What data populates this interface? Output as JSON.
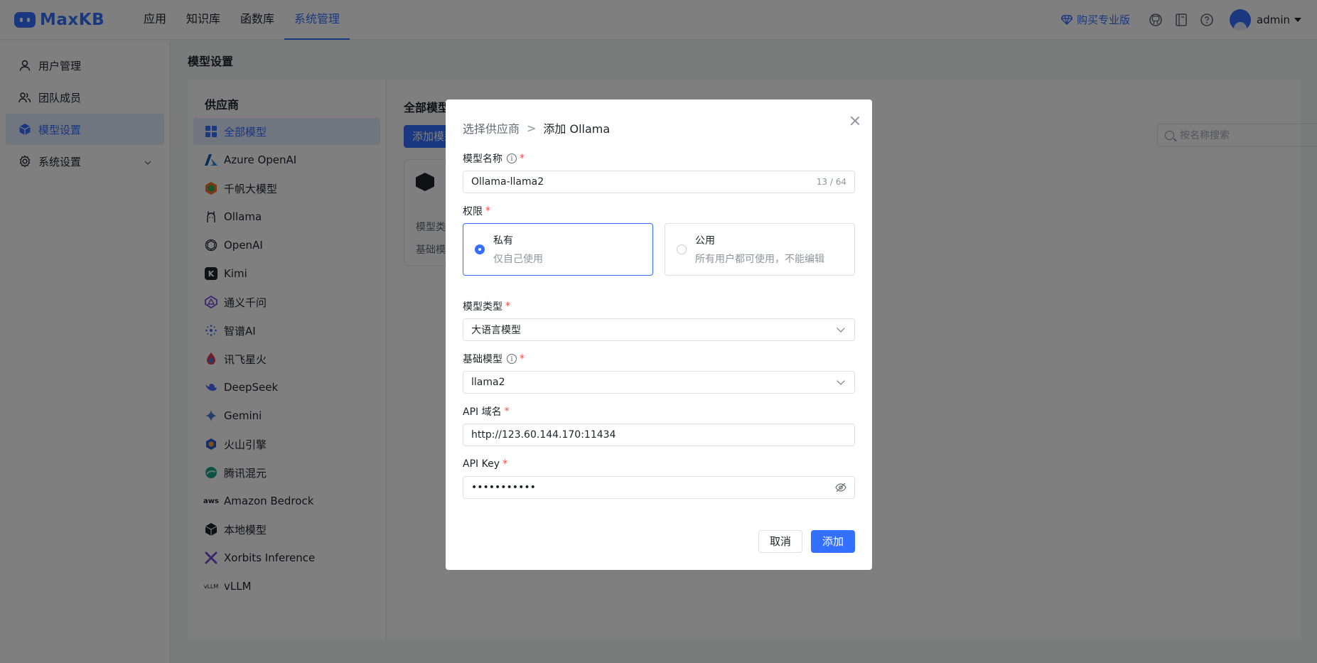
{
  "app": {
    "logo_text": "MaxKB",
    "nav": [
      "应用",
      "知识库",
      "函数库",
      "系统管理"
    ],
    "buy_label": "购买专业版",
    "username": "admin"
  },
  "sidebar": {
    "items": [
      {
        "label": "用户管理",
        "icon": "user-icon"
      },
      {
        "label": "团队成员",
        "icon": "team-icon"
      },
      {
        "label": "模型设置",
        "icon": "cube-icon"
      },
      {
        "label": "系统设置",
        "icon": "gear-icon"
      }
    ]
  },
  "page": {
    "title": "模型设置",
    "providers_title": "供应商",
    "providers": [
      "全部模型",
      "Azure OpenAI",
      "千帆大模型",
      "Ollama",
      "OpenAI",
      "Kimi",
      "通义千问",
      "智谱AI",
      "讯飞星火",
      "DeepSeek",
      "Gemini",
      "火山引擎",
      "腾讯混元",
      "Amazon Bedrock",
      "本地模型",
      "Xorbits Inference",
      "vLLM"
    ],
    "main_title": "全部模型",
    "add_model_label": "添加模型",
    "search_placeholder": "按名称搜索",
    "card_line1": "模型类",
    "card_line2": "基础模"
  },
  "dialog": {
    "breadcrumb_1": "选择供应商",
    "breadcrumb_sep": ">",
    "breadcrumb_2": "添加 Ollama",
    "model_name_label": "模型名称",
    "model_name_value": "Ollama-llama2",
    "model_name_count": "13 / 64",
    "permission_label": "权限",
    "private_title": "私有",
    "private_desc": "仅自己使用",
    "public_title": "公用",
    "public_desc": "所有用户都可使用，不能编辑",
    "model_type_label": "模型类型",
    "model_type_value": "大语言模型",
    "base_model_label": "基础模型",
    "base_model_value": "llama2",
    "api_domain_label": "API 域名",
    "api_domain_value": "http://123.60.144.170:11434",
    "api_key_label": "API Key",
    "api_key_value": "•••••••••••",
    "required_mark": "*",
    "info_glyph": "i",
    "cancel_label": "取消",
    "add_label": "添加"
  },
  "colors": {
    "accent": "#3370ff",
    "required": "#f54a45",
    "overlay": "rgba(0,0,0,0.5)"
  }
}
